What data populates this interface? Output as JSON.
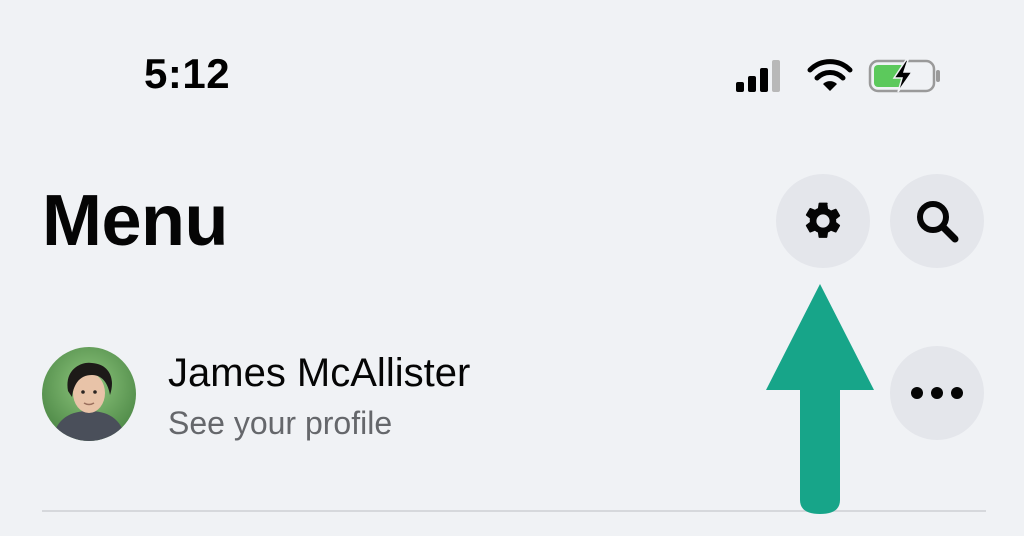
{
  "status_bar": {
    "time": "5:12",
    "icons": [
      "cellular-signal-icon",
      "wifi-icon",
      "battery-charging-icon"
    ]
  },
  "header": {
    "title": "Menu",
    "actions": [
      {
        "name": "settings",
        "icon": "gear-icon"
      },
      {
        "name": "search",
        "icon": "search-icon"
      }
    ]
  },
  "profile": {
    "name": "James McAllister",
    "subtitle": "See your profile",
    "more_icon": "more-horizontal-icon"
  },
  "annotation": {
    "type": "arrow-up",
    "color": "#17a589",
    "points_to": "settings"
  },
  "colors": {
    "background": "#f0f2f5",
    "button_bg": "#e4e6eb",
    "battery_green": "#5cc95c",
    "secondary_text": "#65676b"
  }
}
